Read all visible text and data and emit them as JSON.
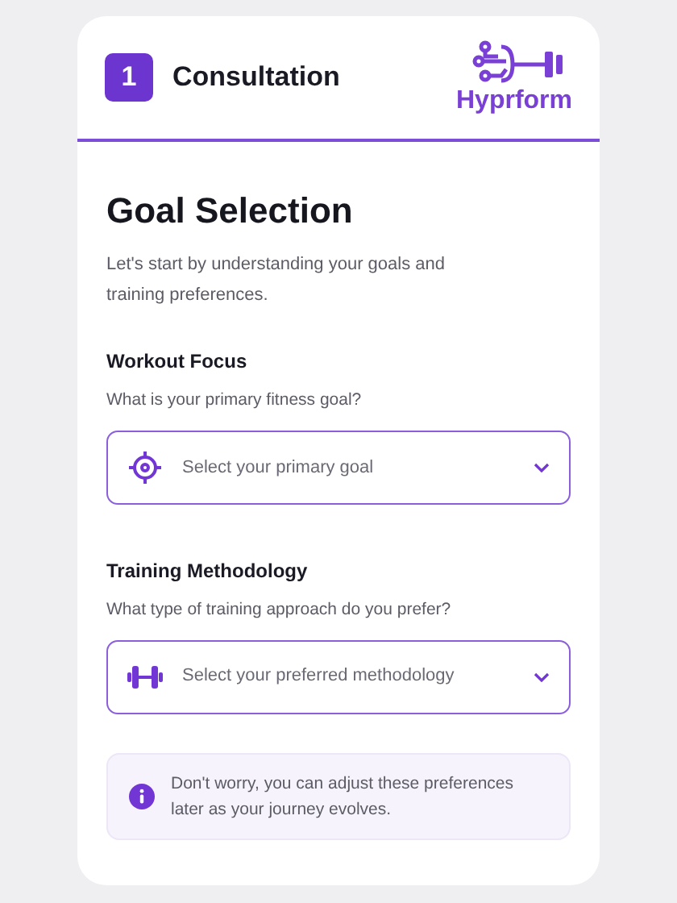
{
  "header": {
    "step": "1",
    "title": "Consultation",
    "logo": "Hyprform"
  },
  "page": {
    "title": "Goal Selection",
    "intro": "Let's start by understanding your goals and training preferences."
  },
  "fields": [
    {
      "label": "Workout Focus",
      "question": "What is your primary fitness goal?",
      "placeholder": "Select your primary goal",
      "kind": "goal"
    },
    {
      "label": "Training Methodology",
      "question": "What type of training approach do you prefer?",
      "placeholder": "Select your preferred methodology",
      "kind": "method"
    }
  ],
  "note": {
    "text": "Don't worry, you can adjust these preferences later as your journey evolves."
  }
}
